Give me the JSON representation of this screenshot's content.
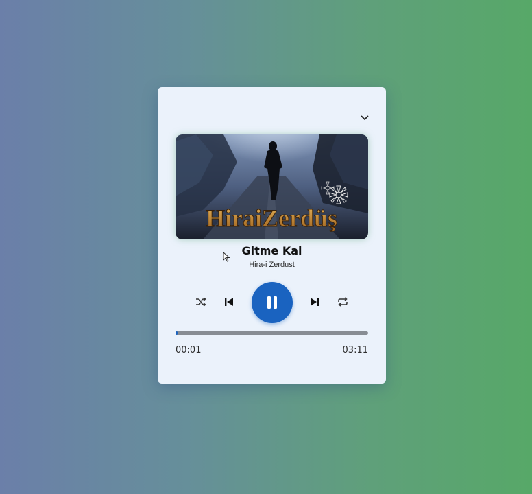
{
  "player": {
    "track": {
      "title": "Gitme Kal",
      "artist": "Hira-i Zerdust",
      "cover_text": "HiraiZerdüş"
    },
    "time": {
      "current": "00:01",
      "total": "03:11"
    },
    "progress_fraction": 0.005,
    "state": "playing"
  },
  "icons": {
    "collapse": "chevron-down-icon",
    "shuffle": "shuffle-icon",
    "previous": "skip-previous-icon",
    "play_pause": "pause-icon",
    "next": "skip-next-icon",
    "repeat": "repeat-icon"
  },
  "colors": {
    "accent": "#1a63c0",
    "card_background": "#ebf2fb",
    "progress_track": "#888d94",
    "background_left": "#6b7fa9",
    "background_right": "#57a868"
  }
}
